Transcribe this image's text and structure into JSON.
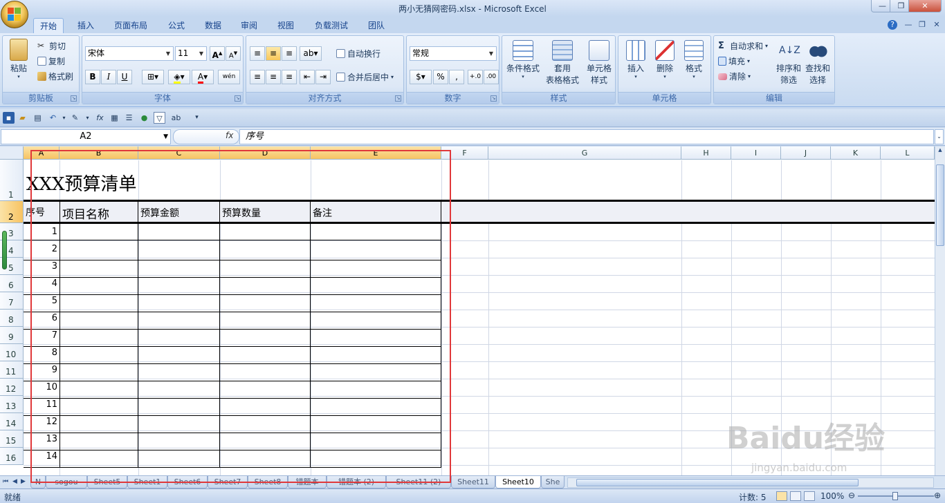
{
  "window": {
    "title": "两小无猜网密码.xlsx - Microsoft Excel"
  },
  "tabs": [
    {
      "label": "开始"
    },
    {
      "label": "插入"
    },
    {
      "label": "页面布局"
    },
    {
      "label": "公式"
    },
    {
      "label": "数据"
    },
    {
      "label": "审阅"
    },
    {
      "label": "视图"
    },
    {
      "label": "负载测试"
    },
    {
      "label": "团队"
    }
  ],
  "ribbon": {
    "clipboard": {
      "label": "剪贴板",
      "paste": "粘贴",
      "cut": "剪切",
      "copy": "复制",
      "format_painter": "格式刷"
    },
    "font": {
      "label": "字体",
      "name": "宋体",
      "size": "11",
      "bold": "B",
      "italic": "I",
      "underline": "U",
      "phonetic": "wén"
    },
    "alignment": {
      "label": "对齐方式",
      "wrap": "自动换行",
      "merge": "合并后居中"
    },
    "number": {
      "label": "数字",
      "format": "常规",
      "percent": "%",
      "comma": ","
    },
    "styles": {
      "label": "样式",
      "conditional": "条件格式",
      "table1": "套用",
      "table2": "表格格式",
      "cellstyle1": "单元格",
      "cellstyle2": "样式"
    },
    "cells": {
      "label": "单元格",
      "insert": "插入",
      "delete": "删除",
      "format": "格式"
    },
    "editing": {
      "label": "编辑",
      "autosum": "自动求和",
      "fill": "填充",
      "clear": "清除",
      "sort1": "排序和",
      "sort2": "筛选",
      "find1": "查找和",
      "find2": "选择"
    }
  },
  "formula_bar": {
    "name_box": "A2",
    "fx": "fx",
    "value": "序号"
  },
  "columns": [
    "A",
    "B",
    "C",
    "D",
    "E",
    "F",
    "G",
    "H",
    "I",
    "J",
    "K",
    "L"
  ],
  "rows": [
    "1",
    "2",
    "3",
    "4",
    "5",
    "6",
    "7",
    "8",
    "9",
    "10",
    "11",
    "12",
    "13",
    "14",
    "15",
    "16"
  ],
  "sheet": {
    "title": "XXX预算清单",
    "headers": [
      "序号",
      "项目名称",
      "预算金额",
      "预算数量",
      "备注"
    ],
    "numbers": [
      "1",
      "2",
      "3",
      "4",
      "5",
      "6",
      "7",
      "8",
      "9",
      "10",
      "11",
      "12",
      "13",
      "14"
    ]
  },
  "sheet_tabs": [
    "N",
    "sogou",
    "Sheet5",
    "Sheet1",
    "Sheet6",
    "Sheet7",
    "Sheet8",
    "错题本",
    "错题本 (2)",
    "Sheet11 (2)",
    "Sheet11",
    "Sheet10",
    "She"
  ],
  "status": {
    "ready": "就绪",
    "count": "计数: 5",
    "zoom": "100%"
  },
  "watermark": {
    "brand": "Baidu经验",
    "url": "jingyan.baidu.com"
  }
}
